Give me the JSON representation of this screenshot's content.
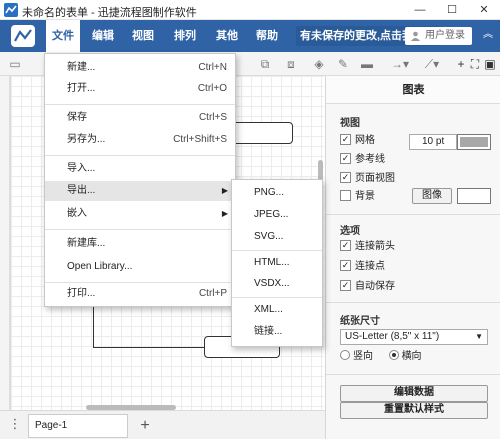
{
  "window": {
    "title": "未命名的表单 - 迅捷流程图制作软件",
    "controls": [
      "—",
      "☐",
      "✕"
    ]
  },
  "menubar": {
    "items": [
      "文件",
      "编辑",
      "视图",
      "排列",
      "其他",
      "帮助"
    ],
    "unsaved": "有未保存的更改,点击我保存",
    "login": "用户登录",
    "collapse": "︽"
  },
  "file_menu": {
    "items": [
      {
        "label": "新建...",
        "shortcut": "Ctrl+N"
      },
      {
        "label": "打开...",
        "shortcut": "Ctrl+O"
      },
      {
        "label": "保存",
        "shortcut": "Ctrl+S"
      },
      {
        "label": "另存为...",
        "shortcut": "Ctrl+Shift+S"
      },
      {
        "label": "导入...",
        "shortcut": ""
      },
      {
        "label": "导出...",
        "shortcut": ""
      },
      {
        "label": "嵌入",
        "shortcut": ""
      },
      {
        "label": "新建库...",
        "shortcut": ""
      },
      {
        "label": "Open Library...",
        "shortcut": ""
      },
      {
        "label": "打印...",
        "shortcut": "Ctrl+P"
      }
    ]
  },
  "export_menu": {
    "items": [
      "PNG...",
      "JPEG...",
      "SVG...",
      "HTML...",
      "VSDX...",
      "XML...",
      "链接..."
    ]
  },
  "panel": {
    "title": "图表",
    "view_section": "视图",
    "grid": "网格",
    "grid_size": "10 pt",
    "guides": "参考线",
    "page_view": "页面视图",
    "background": "背景",
    "image_button": "图像",
    "options_section": "选项",
    "connection_arrows": "连接箭头",
    "connection_points": "连接点",
    "autosave": "自动保存",
    "paper_size_section": "纸张尺寸",
    "paper_size": "US-Letter (8,5\" x 11\")",
    "portrait": "竖向",
    "landscape": "横向",
    "edit_data": "编辑数据",
    "reset_style": "重置默认样式"
  },
  "bottom": {
    "page_tab": "Page-1",
    "add": "+",
    "more": "⋮"
  },
  "colors": {
    "menubar": "#2f63a6",
    "accent": "#2b6fc2"
  }
}
